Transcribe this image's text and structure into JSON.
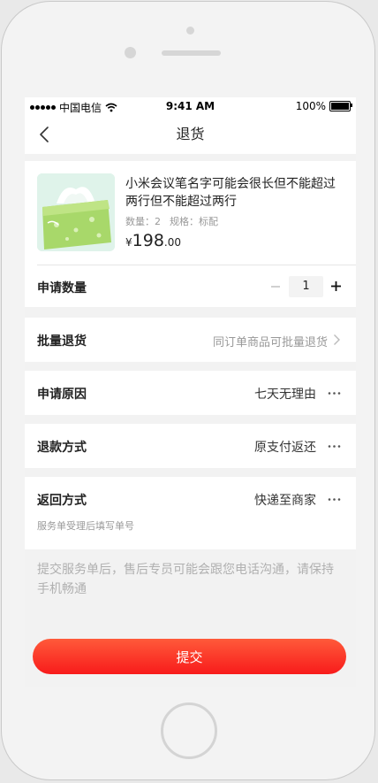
{
  "status_bar": {
    "carrier": "中国电信",
    "time": "9:41 AM",
    "battery": "100%"
  },
  "header": {
    "title": "退货",
    "back_icon": "chevron-left-icon"
  },
  "product": {
    "name": "小米会议笔名字可能会很长但不能超过两行但不能超过两行",
    "quantity_text": "数量：2",
    "spec_text": "规格：标配",
    "price_symbol": "¥",
    "price_integer": "198",
    "price_decimal": ".00"
  },
  "quantity": {
    "label": "申请数量",
    "value": "1"
  },
  "batch": {
    "label": "批量退货",
    "value": "同订单商品可批量退货"
  },
  "reason": {
    "label": "申请原因",
    "value": "七天无理由"
  },
  "refund": {
    "label": "退款方式",
    "value": "原支付返还"
  },
  "return_method": {
    "label": "返回方式",
    "value": "快递至商家",
    "note": "服务单受理后填写单号"
  },
  "notice": "提交服务单后，售后专员可能会跟您电话沟通，请保持手机畅通",
  "submit_label": "提交",
  "colors": {
    "accent": "#f81b1b",
    "accent_light": "#ff5a3a",
    "muted_text": "#999999"
  }
}
